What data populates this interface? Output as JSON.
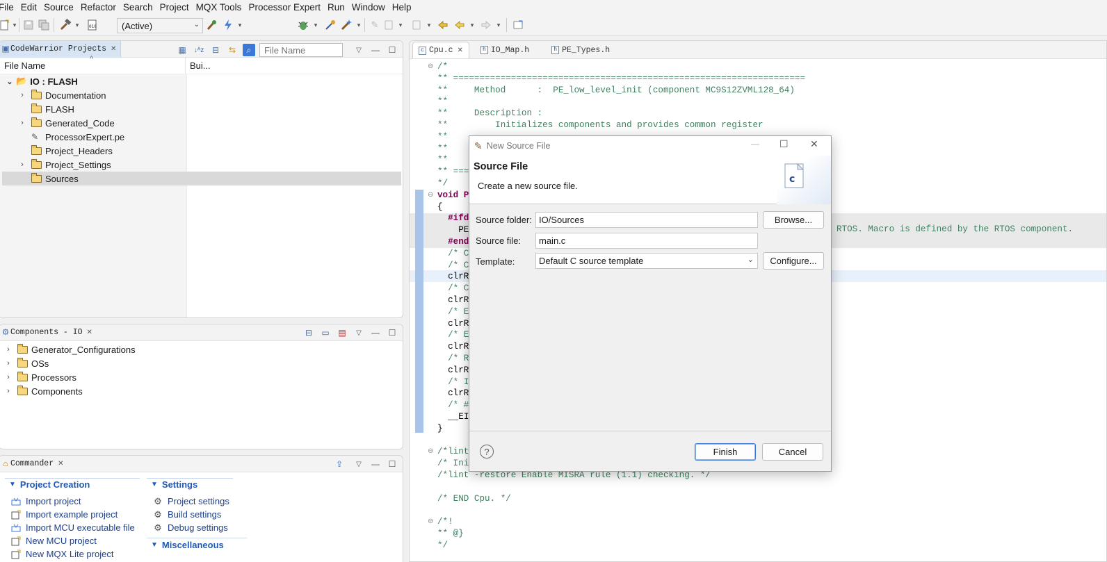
{
  "menu": [
    "File",
    "Edit",
    "Source",
    "Refactor",
    "Search",
    "Project",
    "MQX Tools",
    "Processor Expert",
    "Run",
    "Window",
    "Help"
  ],
  "toolbar": {
    "config_combo": "(Active)"
  },
  "projects_panel": {
    "tab": "CodeWarrior Projects",
    "filter_placeholder": "File Name",
    "col_file": "File Name",
    "col_build": "Bui...",
    "root": "IO : FLASH",
    "items": [
      {
        "label": "Documentation",
        "expandable": true
      },
      {
        "label": "FLASH",
        "expandable": false
      },
      {
        "label": "Generated_Code",
        "expandable": true
      },
      {
        "label": "ProcessorExpert.pe",
        "expandable": false
      },
      {
        "label": "Project_Headers",
        "expandable": false
      },
      {
        "label": "Project_Settings",
        "expandable": true
      },
      {
        "label": "Sources",
        "expandable": false,
        "selected": true
      }
    ]
  },
  "components_panel": {
    "tab": "Components - IO",
    "items": [
      "Generator_Configurations",
      "OSs",
      "Processors",
      "Components"
    ]
  },
  "commander_panel": {
    "tab": "Commander",
    "project_creation": {
      "title": "Project Creation",
      "items": [
        "Import project",
        "Import example project",
        "Import MCU executable file",
        "New MCU project",
        "New MQX Lite project"
      ]
    },
    "settings": {
      "title": "Settings",
      "items": [
        "Project settings",
        "Build settings",
        "Debug settings"
      ]
    },
    "misc": {
      "title": "Miscellaneous"
    }
  },
  "editor": {
    "tabs": [
      "Cpu.c",
      "IO_Map.h",
      "PE_Types.h"
    ],
    "lines": [
      "/*",
      "** ===================================================================",
      "**     Method      :  PE_low_level_init (component MC9S12ZVML128_64)",
      "**",
      "**     Description :",
      "**         Initializes components and provides common register",
      "**",
      "**",
      "**",
      "** ===",
      "*/",
      "void P",
      "{",
      "  #ifd",
      "    PE",
      "  #end",
      "  /* C",
      "  /* C",
      "  clrR",
      "  /* C",
      "  clrR",
      "  /* E",
      "  clrR",
      "  /* E",
      "  clrR",
      "  /* R",
      "  clrR",
      "  /* I",
      "  clrR",
      "  /* #",
      "  __EI",
      "}",
      "",
      "/*lint",
      "/* Ini",
      "/*lint -restore Enable MISRA rule (1.1) checking. */",
      "",
      "/* END Cpu. */",
      "",
      "/*!",
      "** @}",
      "*/"
    ],
    "right_text": "RTOS. Macro is defined by the RTOS component. "
  },
  "dialog": {
    "window_title": "New Source File",
    "heading": "Source File",
    "subheading": "Create a new source file.",
    "source_folder_label": "Source folder:",
    "source_folder_value": "IO/Sources",
    "source_file_label": "Source file:",
    "source_file_value": "main.c",
    "template_label": "Template:",
    "template_value": "Default C source template",
    "browse": "Browse...",
    "configure": "Configure...",
    "finish": "Finish",
    "cancel": "Cancel",
    "help": "?"
  }
}
